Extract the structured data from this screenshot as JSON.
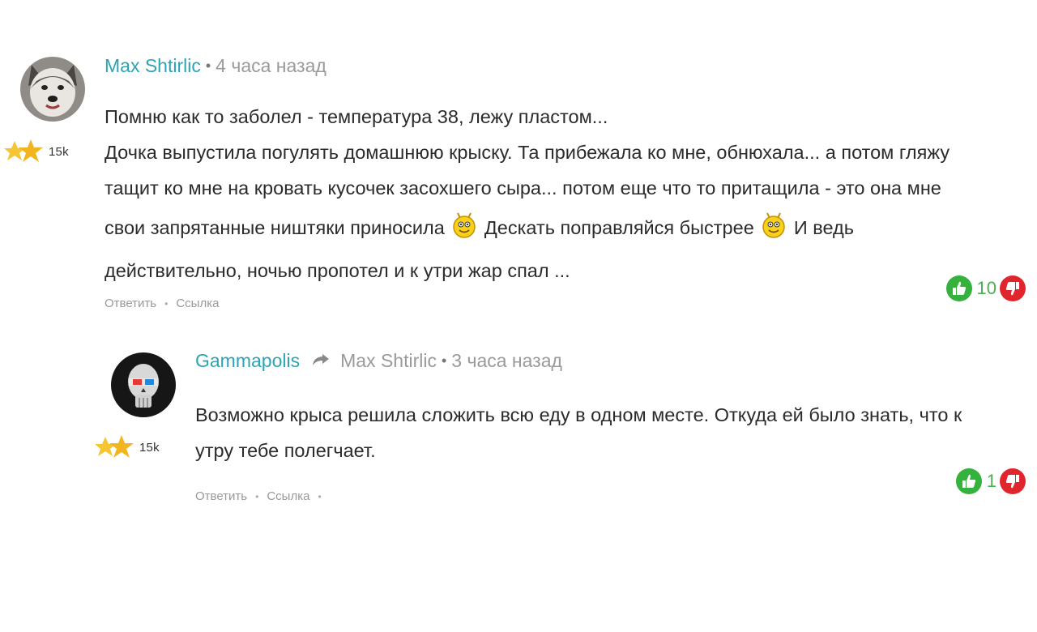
{
  "comments": [
    {
      "author": "Max Shtirlic",
      "time": "4 часа назад",
      "rank_count": "15k",
      "text_lines": [
        "Помню как то заболел - температура 38, лежу пластом...",
        "Дочка выпустила погулять домашнюю крыску. Та прибежала ко мне, обнюхала... а потом гляжу",
        "тащит ко мне на кровать кусочек засохшего сыра... потом еще что то притащила - это она мне"
      ],
      "text_line4_a": "свои запрятанные ништяки приносила",
      "text_line4_b": "Дескать поправляйся быстрее",
      "text_line4_c": "И ведь",
      "text_line5": "действительно, ночью пропотел и к утри жар спал ...",
      "actions": {
        "reply": "Ответить",
        "link": "Ссылка"
      },
      "votes": 10
    },
    {
      "author": "Gammapolis",
      "reply_to": "Max Shtirlic",
      "time": "3 часа назад",
      "rank_count": "15k",
      "text_lines": [
        "Возможно крыса решила сложить всю еду в одном месте. Откуда ей было знать, что к",
        "утру тебе полегчает."
      ],
      "actions": {
        "reply": "Ответить",
        "link": "Ссылка"
      },
      "votes": 1
    }
  ],
  "colors": {
    "author": "#2ea3b4",
    "meta": "#9a9a9a",
    "vote_up": "#35b13e",
    "vote_down": "#e0262c",
    "vote_count": "#4caf50"
  },
  "icons": {
    "avatar_1": "husky-dog-avatar",
    "avatar_2": "skull-3d-glasses-avatar",
    "rank": "two-stars-icon",
    "emoji": "smiley-face-icon",
    "reply_arrow": "reply-arrow-icon",
    "thumbs_up": "thumbs-up-icon",
    "thumbs_down": "thumbs-down-icon"
  }
}
